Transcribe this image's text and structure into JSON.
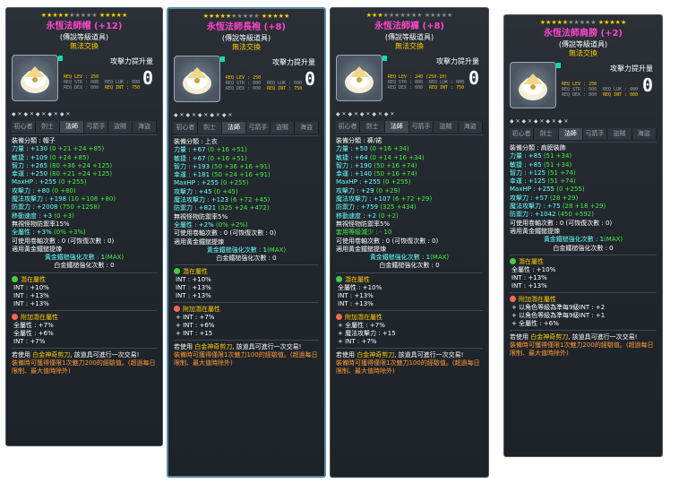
{
  "cards": [
    {
      "stars_on": 5,
      "stars_off": 5,
      "stars_on2": 5,
      "title": "永恆法師帽 (+12)",
      "sub": "(傳說等級道具)",
      "notrade": "無法交換",
      "atk_label": "攻擊力提升量",
      "atk_value": "0",
      "req_lev": "REQ LEV : 250",
      "req_str": "REQ STR : 000",
      "req_luk": "REQ LUK : 000",
      "req_dex": "REQ DEX : 000",
      "req_int": "REQ INT : 750",
      "jobs": [
        "初心者",
        "劍士",
        "法師",
        "弓箭手",
        "盜賊",
        "海盜"
      ],
      "active_job": 2,
      "stats": [
        "裝備分類 : 帽子",
        "力量 : +130 (0 +21 +24 +85)",
        "敏捷 : +109 (0 +24 +85)",
        "智力 : +265 (80 +36 +24 +125)",
        "幸運 : +250 (80 +21 +24 +125)",
        "MaxHP : +255 (0 +255)",
        "攻擊力 : +80 (0 +80)",
        "魔法攻擊力 : +198 (10 +108 +80)",
        "防禦力 : +2008 (750 +1258)",
        "移動速度 : +3 (0 +3)",
        "無視怪物防禦率15%",
        "全屬性 : +3% (0% +3%)",
        "可使用卷軸次數 : 0  (可恢復次數 : 0)",
        "適用黃金鐵鎚提煉",
        "黃金鐵槌強化次數 : 1(MAX)",
        "白金鐵槌強化次數 : 0"
      ],
      "pot_title": "潛在屬性",
      "pot": [
        "INT : +10%",
        "INT : +13%",
        "INT : +13%"
      ],
      "add_title": "附加潛在屬性",
      "add": [
        "全屬性 : +7%",
        "全屬性 : +6%",
        "INT : +7%"
      ],
      "note1a": "若使用",
      "note1b": "白金神奇剪刀",
      "note1c": ", 該道具可進行一次交易!",
      "note2": "裝備時可獲得僅限1次魅力200的經驗值。(超過每日限制、最大值時除外)"
    },
    {
      "stars_on": 5,
      "stars_off": 5,
      "stars_on2": 5,
      "title": "永恆法師長袍 (+8)",
      "sub": "(傳說等級道具)",
      "notrade": "無法交換",
      "atk_label": "攻擊力提升量",
      "atk_value": "0",
      "req_lev": "REQ LEV : 250",
      "req_str": "REQ STR : 000",
      "req_luk": "REQ LUK : 000",
      "req_dex": "REQ DEX : 000",
      "req_int": "REQ INT : 750",
      "jobs": [
        "初心者",
        "劍士",
        "法師",
        "弓箭手",
        "盜賊",
        "海盜"
      ],
      "active_job": 2,
      "stats": [
        "裝備分類 : 上衣",
        "力量 : +67 (0 +16 +51)",
        "敏捷 : +67 (0 +16 +51)",
        "智力 : +193 (50 +36 +16 +91)",
        "幸運 : +181 (50 +24 +16 +91)",
        "MaxHP : +255 (0 +255)",
        "攻擊力 : +45 (0 +45)",
        "魔法攻擊力 : +123 (6 +72 +45)",
        "防禦力 : +821 (325 +24 +472)",
        "無視怪物防禦率5%",
        "全屬性 : +2% (0% +2%)",
        "可使用卷軸次數 : 0  (可恢復次數 : 0)",
        "適用黃金鐵鎚提煉",
        "黃金鐵槌強化次數 : 1(MAX)",
        "白金鐵槌強化次數 : 0"
      ],
      "pot_title": "潛在屬性",
      "pot": [
        "INT : +10%",
        "INT : +13%",
        "INT : +13%"
      ],
      "add_title": "附加潛在屬性",
      "add": [
        "+ INT : +7%",
        "+ INT : +6%",
        "+ INT : +15"
      ],
      "note1a": "若使用",
      "note1b": "白金神奇剪刀",
      "note1c": ", 該道具可進行一次交易!",
      "note2": "裝備時可獲得僅限1次魅力100的經驗值。(超過每日限制、最大值時除外)"
    },
    {
      "stars_on": 3,
      "stars_off": 7,
      "stars_on2": 0,
      "title": "永恆法師褲 (+8)",
      "sub": "(傳說等級道具)",
      "notrade": "無法交換",
      "atk_label": "攻擊力提升量",
      "atk_value": "0",
      "req_lev": "REQ LEV : 240 (250-10)",
      "req_str": "REQ STR : 000",
      "req_luk": "REQ LUK : 000",
      "req_dex": "REQ DEX : 000",
      "req_int": "REQ INT : 750",
      "jobs": [
        "初心者",
        "劍士",
        "法師",
        "弓箭手",
        "盜賊",
        "海盜"
      ],
      "active_job": 2,
      "stats": [
        "裝備分類 : 褲/裙",
        "力量 : +50 (0 +16 +34)",
        "敏捷 : +64 (0 +14 +16 +34)",
        "智力 : +190 (50 +16 +74)",
        "幸運 : +140 (50 +16 +74)",
        "MaxHP : +255 (0 +255)",
        "攻擊力 : +29 (0 +29)",
        "魔法攻擊力 : +107 (6 +72 +29)",
        "防禦力 : +759 (325 +434)",
        "移動速度 : +2 (0 +2)",
        "無視怪物防禦率5%",
        "套用等級減少 : - 10",
        "可使用卷軸次數 : 0  (可恢復次數 : 0)",
        "適用黃金鐵鎚提煉",
        "黃金鐵槌強化次數 : 1(MAX)",
        "白金鐵槌強化次數 : 0"
      ],
      "pot_title": "潛在屬性",
      "pot": [
        "全屬性 : +10%",
        "INT : +13%",
        "INT : +13%"
      ],
      "add_title": "附加潛在屬性",
      "add": [
        "+ 全屬性 : +7%",
        "+ 魔法攻擊力 : +15",
        "+ INT : +7%"
      ],
      "note1a": "若使用",
      "note1b": "白金神奇剪刀",
      "note1c": ", 該道具可進行一次交易!",
      "note2": "裝備時可獲得僅限1次魅力100的經驗值。(超過每日限制、最大值時除外)"
    },
    {
      "stars_on": 5,
      "stars_off": 5,
      "stars_on2": 5,
      "title": "永恆法師肩膀 (+2)",
      "sub": "(傳說等級道具)",
      "notrade": "無法交換",
      "atk_label": "攻擊力提升量",
      "atk_value": "0",
      "req_lev": "REQ LEV : 250",
      "req_str": "REQ STR : 000",
      "req_luk": "REQ LUK : 000",
      "req_dex": "REQ DEX : 000",
      "req_int": "REQ INT : 000",
      "jobs": [
        "初心者",
        "劍士",
        "法師",
        "弓箭手",
        "盜賊",
        "海盜"
      ],
      "active_job": 2,
      "stats": [
        "裝備分類 : 肩膀裝飾",
        "力量 : +85 (51 +34)",
        "敏捷 : +85 (51 +34)",
        "智力 : +125 (51 +74)",
        "幸運 : +125 (51 +74)",
        "MaxHP : +255 (0 +255)",
        "攻擊力 : +57 (28 +29)",
        "魔法攻擊力 : +75 (28 +18 +29)",
        "防禦力 : +1042 (450 +592)",
        "可使用卷軸次數 : 0  (可恢復次數 : 0)",
        "適用黃金鐵鎚提煉",
        "黃金鐵槌強化次數 : 1(MAX)",
        "白金鐵槌強化次數 : 0"
      ],
      "pot_title": "潛在屬性",
      "pot": [
        "全屬性 : +10%",
        "INT : +13%",
        "INT : +13%"
      ],
      "add_title": "附加潛在屬性",
      "add": [
        "+ 以角色等級為準每9級INT : +2",
        "+ 以角色等級為準每9級INT : +1",
        "+ 全屬性 : +6%"
      ],
      "note1a": "若使用",
      "note1b": "白金神奇剪刀",
      "note1c": ", 該道具可進行一次交易!",
      "note2": "裝備時可獲得僅限1次魅力200的經驗值。(超過每日限制、最大值時除外)"
    }
  ],
  "colors": {
    "title": "#ff44cc",
    "star_on": "#ffcc00",
    "star_off": "#8b8b8b",
    "potential": "#44cc44",
    "additional": "#ff6655"
  }
}
